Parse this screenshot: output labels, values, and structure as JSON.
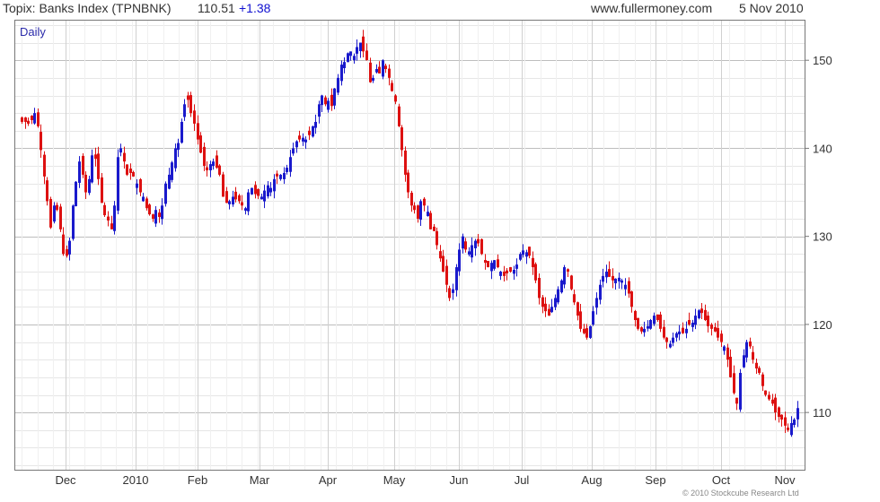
{
  "header": {
    "title": "Topix: Banks Index (TPNBNK)",
    "value": "110.51",
    "change": "+1.38",
    "site": "www.fullermoney.com",
    "date": "5 Nov 2010"
  },
  "footer": {
    "copyright": "© 2010 Stockcube Research Ltd"
  },
  "colors": {
    "up": "#1a1acc",
    "down": "#dd1111",
    "grid": "#d8d8d8",
    "frame": "#777777"
  },
  "chart_data": {
    "type": "candlestick",
    "period_label": "Daily",
    "ylim": [
      103.5,
      154.5
    ],
    "y_ticks": [
      110,
      120,
      130,
      140,
      150
    ],
    "x_ticks": [
      "Dec",
      "2010",
      "Feb",
      "Mar",
      "Apr",
      "May",
      "Jun",
      "Jul",
      "Aug",
      "Sep",
      "Oct",
      "Nov"
    ],
    "grid": true,
    "closes": [
      143.0,
      143.0,
      142.8,
      143.2,
      144.0,
      142.5,
      139.8,
      136.8,
      134.0,
      131.0,
      133.5,
      133.0,
      130.8,
      128.0,
      127.8,
      129.5,
      133.5,
      136.2,
      138.5,
      137.0,
      135.0,
      136.5,
      139.2,
      138.8,
      136.5,
      133.8,
      132.4,
      131.8,
      130.8,
      133.5,
      139.0,
      140.0,
      138.5,
      137.0,
      137.2,
      136.8,
      136.0,
      135.0,
      134.5,
      133.2,
      132.5,
      132.0,
      133.0,
      132.2,
      133.5,
      136.0,
      137.0,
      138.4,
      140.0,
      140.6,
      143.0,
      145.0,
      145.5,
      144.0,
      142.8,
      141.0,
      139.5,
      138.0,
      137.5,
      138.2,
      138.5,
      137.8,
      137.0,
      134.5,
      133.8,
      134.0,
      134.5,
      134.2,
      134.0,
      133.5,
      133.2,
      135.0,
      135.5,
      134.8,
      134.6,
      134.5,
      135.2,
      135.8,
      135.5,
      136.5,
      136.8,
      137.0,
      137.2,
      137.8,
      139.0,
      140.0,
      140.8,
      141.0,
      141.2,
      141.0,
      141.5,
      142.5,
      143.0,
      145.0,
      146.0,
      145.0,
      145.4,
      144.8,
      146.8,
      148.0,
      149.5,
      149.8,
      150.8,
      151.0,
      150.5,
      151.5,
      152.0,
      151.0,
      150.0,
      147.5,
      148.0,
      149.0,
      148.5,
      150.0,
      149.0,
      148.0,
      146.5,
      145.3,
      142.5,
      139.8,
      137.0,
      135.0,
      133.5,
      133.0,
      132.0,
      134.0,
      133.5,
      132.8,
      130.8,
      130.6,
      129.0,
      127.5,
      126.0,
      124.5,
      123.0,
      124.0,
      126.5,
      128.5,
      130.0,
      128.5,
      128.3,
      129.0,
      129.5,
      129.2,
      128.0,
      127.0,
      126.5,
      127.0,
      127.3,
      126.5,
      126.0,
      125.5,
      125.8,
      126.0,
      126.2,
      126.8,
      128.0,
      128.4,
      128.2,
      127.8,
      126.5,
      125.0,
      123.0,
      122.0,
      121.5,
      121.0,
      122.0,
      123.0,
      124.0,
      125.0,
      126.5,
      126.0,
      124.0,
      122.5,
      121.0,
      119.5,
      119.0,
      118.5,
      119.8,
      121.5,
      123.0,
      124.5,
      125.5,
      126.0,
      125.4,
      125.0,
      125.2,
      125.3,
      125.0,
      124.5,
      123.5,
      122.0,
      120.5,
      119.5,
      119.2,
      119.5,
      119.8,
      120.5,
      121.0,
      120.5,
      119.5,
      118.5,
      118.0,
      117.8,
      118.5,
      119.0,
      119.2,
      119.0,
      119.5,
      120.0,
      120.2,
      121.0,
      121.6,
      121.3,
      120.5,
      119.8,
      119.5,
      119.2,
      118.5,
      118.0,
      117.5,
      116.0,
      114.0,
      112.2,
      111.0,
      114.5,
      116.5,
      118.0,
      117.5,
      116.0,
      115.0,
      114.5,
      113.0,
      112.0,
      111.5,
      111.0,
      110.0,
      109.5,
      109.2,
      108.5,
      108.0,
      108.8,
      109.2,
      110.5
    ],
    "x_range_sessions": [
      0,
      242
    ]
  }
}
